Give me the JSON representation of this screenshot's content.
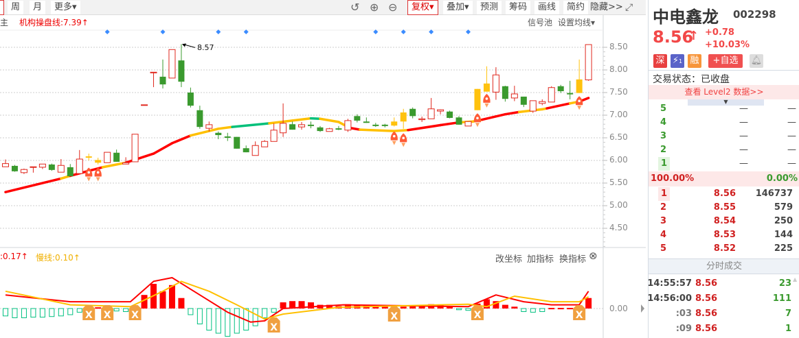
{
  "toolbar": {
    "left": [
      "周",
      "月",
      "更多▾"
    ],
    "fuquan": "复权▾",
    "diejia": "叠加▾",
    "yuce": "预测",
    "chouma": "筹码",
    "huaxian": "画线",
    "jianyue": "简约",
    "yincang": "隐藏>>"
  },
  "main": {
    "indicator_partial": "主",
    "indicator_label": "机构操盘线:7.39↑",
    "signal_pool": "信号池",
    "set_ma": "设置均线▾",
    "peak_label": "8.57",
    "price_ticks": [
      "8.50",
      "8.00",
      "7.50",
      "7.00",
      "6.50",
      "6.00",
      "5.50",
      "5.00",
      "4.50"
    ]
  },
  "sub": {
    "fast_label": ":0.17↑",
    "slow_label": "慢线:0.10↑",
    "change_axis": "改坐标",
    "add_indicator": "加指标",
    "switch_indicator": "换指标",
    "zero_tick": "0.00"
  },
  "colors": {
    "up": "#e0281e",
    "down": "#3a9a2e",
    "yellow": "#ffc20e",
    "ma_red": "#ff0000",
    "ma_yellow": "#ffc000",
    "ma_teal": "#00c07a",
    "hist_down": "#00c080",
    "diamond": "#3b8cff",
    "marker": "#f0a040"
  },
  "chart_data": {
    "type": "candlestick",
    "ylim": [
      4.3,
      8.8
    ],
    "candles": [
      [
        5.86,
        6.02,
        5.86,
        5.93,
        "up"
      ],
      [
        5.88,
        5.9,
        5.75,
        5.76,
        "down"
      ],
      [
        5.73,
        5.82,
        5.7,
        5.8,
        "up"
      ],
      [
        5.85,
        5.86,
        5.73,
        5.86,
        "up"
      ],
      [
        5.85,
        5.92,
        5.81,
        5.92,
        "up"
      ],
      [
        5.91,
        5.93,
        5.77,
        5.79,
        "down"
      ],
      [
        5.74,
        6.03,
        5.74,
        5.89,
        "up"
      ],
      [
        5.85,
        5.92,
        5.65,
        5.65,
        "down"
      ],
      [
        5.71,
        6.23,
        5.71,
        6.03,
        "up"
      ],
      [
        6.07,
        6.15,
        6.0,
        6.09,
        "yellow"
      ],
      [
        5.95,
        6.06,
        5.91,
        6.01,
        "yellow"
      ],
      [
        5.95,
        6.18,
        5.95,
        6.18,
        "up"
      ],
      [
        6.17,
        6.24,
        5.97,
        5.97,
        "down"
      ],
      [
        5.92,
        6.07,
        5.92,
        5.95,
        "up"
      ],
      [
        5.97,
        6.58,
        5.97,
        6.58,
        "up"
      ],
      [
        7.23,
        7.23,
        7.23,
        7.23,
        "up"
      ],
      [
        7.95,
        7.95,
        7.62,
        7.95,
        "up"
      ],
      [
        7.85,
        8.23,
        7.59,
        7.68,
        "down"
      ],
      [
        7.82,
        8.45,
        7.82,
        8.45,
        "up"
      ],
      [
        8.21,
        8.57,
        7.62,
        7.74,
        "down"
      ],
      [
        7.5,
        7.61,
        7.17,
        7.21,
        "down"
      ],
      [
        7.11,
        7.21,
        6.7,
        6.74,
        "down"
      ],
      [
        6.71,
        6.86,
        6.64,
        6.79,
        "up"
      ],
      [
        6.61,
        6.64,
        6.47,
        6.56,
        "down"
      ],
      [
        6.53,
        6.61,
        6.43,
        6.53,
        "down"
      ],
      [
        6.52,
        6.52,
        6.26,
        6.26,
        "down"
      ],
      [
        6.27,
        6.33,
        6.18,
        6.18,
        "down"
      ],
      [
        6.11,
        6.42,
        6.11,
        6.33,
        "up"
      ],
      [
        6.3,
        6.45,
        6.3,
        6.42,
        "up"
      ],
      [
        6.42,
        6.82,
        6.42,
        6.67,
        "up"
      ],
      [
        6.61,
        7.26,
        6.52,
        6.82,
        "up"
      ],
      [
        6.8,
        6.86,
        6.68,
        6.68,
        "down"
      ],
      [
        6.74,
        6.85,
        6.68,
        6.79,
        "up"
      ],
      [
        6.79,
        6.86,
        6.71,
        6.78,
        "down"
      ],
      [
        6.73,
        6.76,
        6.63,
        6.65,
        "down"
      ],
      [
        6.64,
        6.72,
        6.64,
        6.7,
        "up"
      ],
      [
        6.71,
        6.76,
        6.67,
        6.7,
        "down"
      ],
      [
        6.67,
        6.92,
        6.63,
        6.88,
        "up"
      ],
      [
        6.98,
        7.02,
        6.84,
        6.88,
        "down"
      ],
      [
        6.86,
        6.95,
        6.83,
        6.83,
        "down"
      ],
      [
        6.79,
        6.83,
        6.74,
        6.78,
        "down"
      ],
      [
        6.79,
        6.81,
        6.73,
        6.78,
        "down"
      ],
      [
        6.77,
        6.95,
        6.75,
        6.86,
        "yellow"
      ],
      [
        6.86,
        7.14,
        6.7,
        7.06,
        "yellow"
      ],
      [
        7.14,
        7.17,
        6.93,
        6.98,
        "down"
      ],
      [
        6.9,
        6.97,
        6.85,
        6.92,
        "up"
      ],
      [
        6.92,
        7.38,
        6.92,
        7.14,
        "up"
      ],
      [
        7.09,
        7.13,
        7.02,
        7.12,
        "up"
      ],
      [
        7.08,
        7.1,
        6.93,
        6.94,
        "down"
      ],
      [
        6.95,
        6.98,
        6.79,
        6.79,
        "down"
      ],
      [
        6.76,
        6.86,
        6.76,
        6.86,
        "up"
      ],
      [
        7.11,
        7.58,
        7.11,
        7.58,
        "yellow"
      ],
      [
        7.52,
        8.08,
        7.52,
        7.7,
        "yellow"
      ],
      [
        7.51,
        8.06,
        7.34,
        7.89,
        "up"
      ],
      [
        7.64,
        7.65,
        7.3,
        7.36,
        "down"
      ],
      [
        7.38,
        7.65,
        7.31,
        7.47,
        "up"
      ],
      [
        7.41,
        7.41,
        7.18,
        7.23,
        "down"
      ],
      [
        7.09,
        7.32,
        7.05,
        7.32,
        "up"
      ],
      [
        7.26,
        7.35,
        7.22,
        7.3,
        "up"
      ],
      [
        7.29,
        7.64,
        7.29,
        7.61,
        "up"
      ],
      [
        7.64,
        7.67,
        7.49,
        7.53,
        "down"
      ],
      [
        7.49,
        7.76,
        7.35,
        7.46,
        "down"
      ],
      [
        7.49,
        8.23,
        7.49,
        7.79,
        "yellow"
      ],
      [
        7.78,
        8.56,
        7.76,
        8.56,
        "up"
      ]
    ],
    "ma": [
      [
        0,
        5.3,
        "r"
      ],
      [
        6,
        5.6,
        "y"
      ],
      [
        7,
        5.66,
        "r"
      ],
      [
        10.5,
        5.85,
        "y"
      ],
      [
        13,
        5.95,
        "r"
      ],
      [
        16,
        6.15,
        "r"
      ],
      [
        18,
        6.38,
        "r"
      ],
      [
        20,
        6.55,
        "y"
      ],
      [
        23,
        6.7,
        "y"
      ],
      [
        24.5,
        6.74,
        "t"
      ],
      [
        28.5,
        6.82,
        "y"
      ],
      [
        31,
        6.88,
        "y"
      ],
      [
        33,
        6.93,
        "t"
      ],
      [
        34,
        6.92,
        "y"
      ],
      [
        36,
        6.85,
        "y"
      ],
      [
        37.2,
        6.72,
        "r"
      ],
      [
        38.3,
        6.68,
        "y"
      ],
      [
        42,
        6.65,
        "y"
      ],
      [
        43.5,
        6.67,
        "r"
      ],
      [
        47,
        6.78,
        "r"
      ],
      [
        49,
        6.84,
        "y"
      ],
      [
        50.5,
        6.86,
        "y"
      ],
      [
        51.5,
        6.9,
        "r"
      ],
      [
        54,
        7.02,
        "r"
      ],
      [
        55.5,
        7.07,
        "y"
      ],
      [
        58,
        7.13,
        "y"
      ],
      [
        58.5,
        7.15,
        "r"
      ],
      [
        61,
        7.26,
        "y"
      ],
      [
        62,
        7.3,
        "r"
      ],
      [
        63,
        7.38,
        "r"
      ]
    ],
    "peak_index": 19,
    "diamonds": [
      11,
      17,
      23,
      26,
      40,
      43,
      46,
      50
    ],
    "rockets": [
      [
        9,
        5.72
      ],
      [
        10,
        5.72
      ],
      [
        42,
        6.52
      ],
      [
        43,
        6.48
      ],
      [
        51,
        6.92
      ],
      [
        52,
        7.35
      ],
      [
        62,
        7.3
      ]
    ],
    "macd_hist": [
      -0.12,
      -0.15,
      -0.15,
      -0.14,
      -0.14,
      -0.13,
      -0.12,
      -0.1,
      -0.06,
      -0.02,
      0.02,
      0.03,
      -0.04,
      -0.05,
      0.05,
      0.22,
      0.4,
      0.28,
      0.38,
      0.17,
      -0.1,
      -0.25,
      -0.35,
      -0.4,
      -0.45,
      -0.4,
      -0.35,
      -0.28,
      -0.15,
      -0.06,
      0.1,
      0.12,
      0.12,
      0.1,
      0.06,
      0.06,
      0.04,
      0.07,
      0.06,
      0.06,
      0.04,
      0.03,
      0.01,
      0.03,
      0.05,
      0.05,
      0.07,
      0.06,
      0.04,
      -0.02,
      -0.03,
      0.08,
      0.15,
      0.12,
      0.06,
      0.03,
      -0.05,
      -0.06,
      -0.05,
      0.01,
      0.01,
      0.01,
      0.0,
      0.17
    ],
    "macd_fast": [
      [
        0,
        0.22
      ],
      [
        7,
        0.11
      ],
      [
        13.5,
        0.11
      ],
      [
        16,
        0.44
      ],
      [
        18,
        0.5
      ],
      [
        21,
        0.22
      ],
      [
        24,
        -0.06
      ],
      [
        26.5,
        -0.22
      ],
      [
        28,
        -0.2
      ],
      [
        30,
        0.0
      ],
      [
        36.5,
        0.06
      ],
      [
        50,
        0.03
      ],
      [
        53,
        0.22
      ],
      [
        56,
        0.11
      ],
      [
        59,
        0.06
      ],
      [
        62,
        0.06
      ],
      [
        63,
        0.28
      ]
    ],
    "macd_slow": [
      [
        0,
        0.28
      ],
      [
        7,
        0.06
      ],
      [
        13.5,
        0.03
      ],
      [
        17,
        0.28
      ],
      [
        19,
        0.44
      ],
      [
        22,
        0.28
      ],
      [
        25,
        0.06
      ],
      [
        28,
        -0.17
      ],
      [
        30,
        -0.09
      ],
      [
        36,
        0.02
      ],
      [
        50,
        0.07
      ],
      [
        52,
        0.03
      ],
      [
        55,
        0.2
      ],
      [
        59,
        0.11
      ],
      [
        62,
        0.11
      ],
      [
        63,
        0.19
      ]
    ],
    "cross_markers": [
      9,
      11,
      14,
      29,
      42,
      51,
      62
    ]
  },
  "quote": {
    "name": "中电鑫龙",
    "code": "002298",
    "price": "8.56",
    "arrow": "↑",
    "change": "+0.78",
    "change_pct": "+10.03%",
    "badges": {
      "shen": "深",
      "flash": "1",
      "rong": "融",
      "add_watch": "+自选"
    },
    "status": "交易状态：已收盘",
    "level2": "查看 Level2 数据>>",
    "sell": [
      {
        "lv": "5",
        "p": "—",
        "v": "—"
      },
      {
        "lv": "4",
        "p": "—",
        "v": "—"
      },
      {
        "lv": "3",
        "p": "—",
        "v": "—"
      },
      {
        "lv": "2",
        "p": "—",
        "v": "—"
      },
      {
        "lv": "1",
        "p": "—",
        "v": "—"
      }
    ],
    "ratio_buy": "100.00%",
    "ratio_sell": "0.00%",
    "buy": [
      {
        "lv": "1",
        "p": "8.56",
        "v": "146737"
      },
      {
        "lv": "2",
        "p": "8.55",
        "v": "579"
      },
      {
        "lv": "3",
        "p": "8.54",
        "v": "250"
      },
      {
        "lv": "4",
        "p": "8.53",
        "v": "144"
      },
      {
        "lv": "5",
        "p": "8.52",
        "v": "225"
      }
    ],
    "ticks_title": "分时成交",
    "ticks": [
      {
        "t": "14:55:57",
        "p": "8.56",
        "v": "23"
      },
      {
        "t": "14:56:00",
        "p": "8.56",
        "v": "111"
      },
      {
        "t": ":03",
        "p": "8.56",
        "v": "7"
      },
      {
        "t": ":09",
        "p": "8.56",
        "v": "1"
      }
    ]
  }
}
